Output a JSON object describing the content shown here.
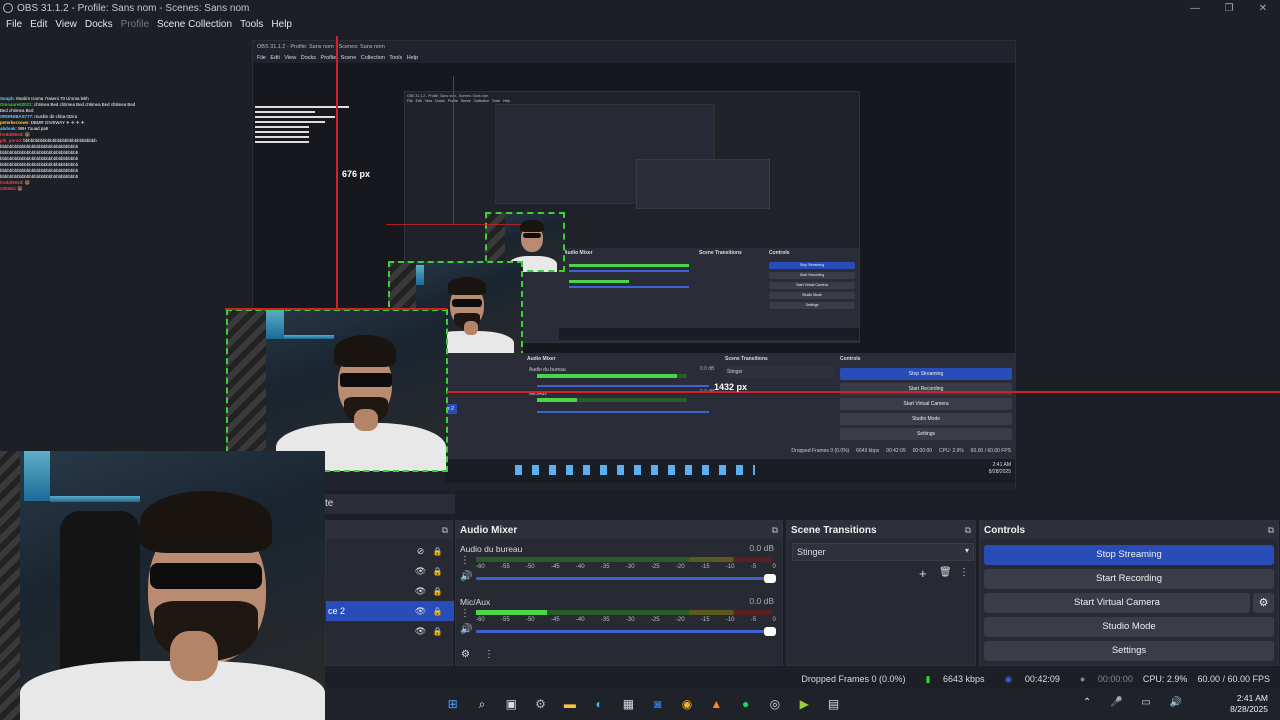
{
  "window": {
    "title": "OBS 31.1.2 - Profile: Sans nom - Scenes: Sans nom",
    "controls": [
      "—",
      "❐",
      "✕"
    ]
  },
  "menu": {
    "items": [
      {
        "label": "File",
        "disabled": false
      },
      {
        "label": "Edit",
        "disabled": false
      },
      {
        "label": "View",
        "disabled": false
      },
      {
        "label": "Docks",
        "disabled": false
      },
      {
        "label": "Profile",
        "disabled": true
      },
      {
        "label": "Scene Collection",
        "disabled": false
      },
      {
        "label": "Tools",
        "disabled": false
      },
      {
        "label": "Help",
        "disabled": false
      }
    ]
  },
  "preview": {
    "chat_lines": [
      {
        "user": "Souph",
        "text": ": Muslim Izoma 7raseni 70 Ui'sma lekh",
        "tone": "blue"
      },
      {
        "user": "Omnaure52021",
        "text": ": chtimea Bed chtimea Bed chtimea Bed chtimea Bed",
        "tone": "green"
      },
      {
        "user": "",
        "text": "Bed chtimea Bed",
        "tone": "blue"
      },
      {
        "user": "SRDREBAS777",
        "text": ": muslim dir chba t3zira",
        "tone": "blue"
      },
      {
        "user": "peterkerxowe",
        "text": ": DBMR GIVEWAY ✈ ✈ ✈ ✈",
        "tone": "gold"
      },
      {
        "user": "abdouk",
        "text": ": 98H 7ouad pa9",
        "tone": "blue"
      },
      {
        "user": "freddi90sd",
        "text": ": 🐻",
        "tone": "red"
      },
      {
        "user": "pik_purso",
        "text": ": bbbbbbbbbbbbbbbbbbbbbbbbbbbbbb",
        "tone": "red"
      },
      {
        "user": "",
        "text": "bbbbbbbbbbbbbbbbbbbbbbbbbbbbbbbb",
        "tone": "blue"
      },
      {
        "user": "",
        "text": "bbbbbbbbbbbbbbbbbbbbbbbbbbbbbbbb",
        "tone": "blue"
      },
      {
        "user": "",
        "text": "bbbbbbbbbbbbbbbbbbbbbbbbbbbbbbbb",
        "tone": "blue"
      },
      {
        "user": "",
        "text": "bbbbbbbbbbbbbbbbbbbbbbbbbbbbbbbb",
        "tone": "blue"
      },
      {
        "user": "",
        "text": "bbbbbbbbbbbbbbbbbbbbbbbbbbbbbbbb",
        "tone": "blue"
      },
      {
        "user": "",
        "text": "bbbbbbbbbbbbbbbbbbbbbbbbbbbbbbbb",
        "tone": "blue"
      },
      {
        "user": "freddi90sd",
        "text": ": 🐻",
        "tone": "red"
      },
      {
        "user": "2008ds",
        "text": ": 🐻",
        "tone": "red"
      }
    ],
    "nested_title": "OBS 31.1.2 - Profile: Sans nom - Scenes: Sans nom",
    "nested_menu": "File Edit View Docks Profile Scene Collection Tools Help",
    "dim_vertical": "676 px",
    "dim_horizontal": "1432 px",
    "nested_docks": {
      "audio_mixer": "Audio Mixer",
      "audio_ch1": "Audio du bureau",
      "audio_ch2": "Mic/Aux",
      "db": "0.0 dB",
      "scene_transitions": "Scene Transitions",
      "stinger": "Stinger",
      "controls": "Controls",
      "btns": [
        "Stop Streaming",
        "Start Recording",
        "Start Virtual Camera",
        "Studio Mode",
        "Settings"
      ],
      "source_sel": "e 2",
      "status": "Dropped Frames 0 (0.0%)     6643 kbps     00:42:09     00:00:00     CPU: 2.9%     60.00 / 60.00 FPS",
      "clock_time": "2:41 AM",
      "clock_date": "8/28/2025"
    }
  },
  "docks": {
    "tab_fragment": "te",
    "sources": {
      "rows": [
        {
          "name": "",
          "visible": "hidden",
          "locked": true,
          "selected": false
        },
        {
          "name": "",
          "visible": "shown",
          "locked": true,
          "selected": false
        },
        {
          "name": "",
          "visible": "shown",
          "locked": true,
          "selected": false
        },
        {
          "name": "ce 2",
          "visible": "shown",
          "locked": true,
          "selected": true
        },
        {
          "name": "",
          "visible": "shown",
          "locked": true,
          "selected": false
        }
      ]
    },
    "audio_mixer": {
      "title": "Audio Mixer",
      "channels": [
        {
          "name": "Audio du bureau",
          "db": "0.0 dB",
          "level": 0.0
        },
        {
          "name": "Mic/Aux",
          "db": "0.0 dB",
          "level": 0.24
        }
      ],
      "scale": [
        "-60",
        "-55",
        "-50",
        "-45",
        "-40",
        "-35",
        "-30",
        "-25",
        "-20",
        "-15",
        "-10",
        "-5",
        "0"
      ]
    },
    "scene_transitions": {
      "title": "Scene Transitions",
      "selected": "Stinger"
    },
    "controls": {
      "title": "Controls",
      "stop_streaming": "Stop Streaming",
      "start_recording": "Start Recording",
      "start_virtual_camera": "Start Virtual Camera",
      "studio_mode": "Studio Mode",
      "settings": "Settings"
    }
  },
  "status": {
    "dropped_frames": "Dropped Frames 0 (0.0%)",
    "bitrate": "6643 kbps",
    "stream_time": "00:42:09",
    "record_time": "00:00:00",
    "cpu": "CPU: 2.9%",
    "fps": "60.00 / 60.00 FPS"
  },
  "taskbar": {
    "icons": [
      "windows-start",
      "search",
      "task-view",
      "settings",
      "file-explorer",
      "edge",
      "store",
      "outlook",
      "chrome",
      "aws",
      "spotify",
      "obs",
      "media",
      "calculator"
    ],
    "clock_time": "2:41 AM",
    "clock_date": "8/28/2025"
  },
  "colors": {
    "accent_blue": "#284cb8",
    "dashed_green": "#3ccf3c",
    "measure_red": "#d21f2b",
    "meter_green": "#49d649"
  }
}
